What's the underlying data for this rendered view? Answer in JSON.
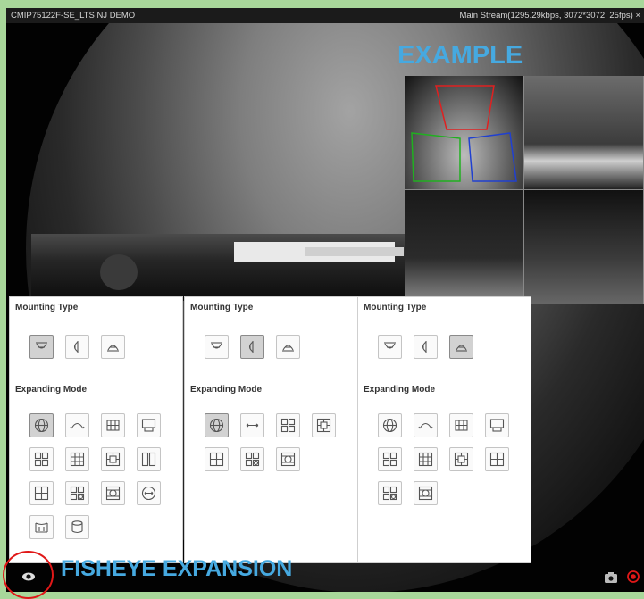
{
  "titlebar": {
    "camera_name": "CMIP75122F-SE_LTS NJ DEMO",
    "stream_info": "Main Stream(1295.29kbps, 3072*3072, 25fps)",
    "close_glyph": "×"
  },
  "annotations": {
    "example": "EXAMPLE",
    "fisheye_expansion": "FISHEYE EXPANSION"
  },
  "panels": [
    {
      "mounting_title": "Mounting Type",
      "expanding_title": "Expanding Mode",
      "mounting": [
        {
          "icon": "ceiling-mount-icon",
          "selected": true
        },
        {
          "icon": "wall-mount-icon",
          "selected": false
        },
        {
          "icon": "desktop-mount-icon",
          "selected": false
        }
      ],
      "modes": [
        {
          "icon": "fisheye-view-icon",
          "selected": true
        },
        {
          "icon": "180-panorama-icon",
          "selected": false
        },
        {
          "icon": "360-panorama-icon",
          "selected": false
        },
        {
          "icon": "panorama-ptz-icon",
          "selected": false
        },
        {
          "icon": "panorama-3ptz-icon",
          "selected": false
        },
        {
          "icon": "panorama-6ptz-icon",
          "selected": false
        },
        {
          "icon": "panorama-8ptz-icon",
          "selected": false
        },
        {
          "icon": "dual-180-icon",
          "selected": false
        },
        {
          "icon": "quad-ptz-icon",
          "selected": false
        },
        {
          "icon": "fisheye-3ptz-icon",
          "selected": false
        },
        {
          "icon": "fisheye-8ptz-icon",
          "selected": false
        },
        {
          "icon": "radial-expansion-icon",
          "selected": false
        },
        {
          "icon": "cylinder-expansion-icon",
          "selected": false
        },
        {
          "icon": "cylinder-icon",
          "selected": false
        }
      ]
    },
    {
      "mounting_title": "Mounting Type",
      "expanding_title": "Expanding Mode",
      "mounting": [
        {
          "icon": "ceiling-mount-icon",
          "selected": false
        },
        {
          "icon": "wall-mount-icon",
          "selected": true
        },
        {
          "icon": "desktop-mount-icon",
          "selected": false
        }
      ],
      "modes": [
        {
          "icon": "fisheye-view-icon",
          "selected": true
        },
        {
          "icon": "horizontal-panorama-icon",
          "selected": false
        },
        {
          "icon": "panorama-3ptz-icon",
          "selected": false
        },
        {
          "icon": "panorama-8ptz-icon",
          "selected": false
        },
        {
          "icon": "quad-ptz-icon",
          "selected": false
        },
        {
          "icon": "fisheye-3ptz-icon",
          "selected": false
        },
        {
          "icon": "fisheye-8ptz-icon",
          "selected": false
        }
      ]
    },
    {
      "mounting_title": "Mounting Type",
      "expanding_title": "Expanding Mode",
      "mounting": [
        {
          "icon": "ceiling-mount-icon",
          "selected": false
        },
        {
          "icon": "wall-mount-icon",
          "selected": false
        },
        {
          "icon": "desktop-mount-icon",
          "selected": true
        }
      ],
      "modes": [
        {
          "icon": "fisheye-view-icon",
          "selected": false
        },
        {
          "icon": "180-panorama-icon",
          "selected": false
        },
        {
          "icon": "360-panorama-icon",
          "selected": false
        },
        {
          "icon": "panorama-ptz-icon",
          "selected": false
        },
        {
          "icon": "panorama-3ptz-icon",
          "selected": false
        },
        {
          "icon": "panorama-6ptz-icon",
          "selected": false
        },
        {
          "icon": "panorama-8ptz-icon",
          "selected": false
        },
        {
          "icon": "quad-ptz-icon",
          "selected": false
        },
        {
          "icon": "fisheye-3ptz-icon",
          "selected": false
        },
        {
          "icon": "fisheye-8ptz-icon",
          "selected": false
        }
      ]
    }
  ],
  "toolbar": [
    {
      "icon": "eye-icon"
    },
    {
      "icon": "camera-icon"
    },
    {
      "icon": "record-icon"
    }
  ],
  "colors": {
    "annotation_blue": "#46a9e0",
    "highlight_red": "#e01818",
    "background_green": "#a8d79a"
  }
}
